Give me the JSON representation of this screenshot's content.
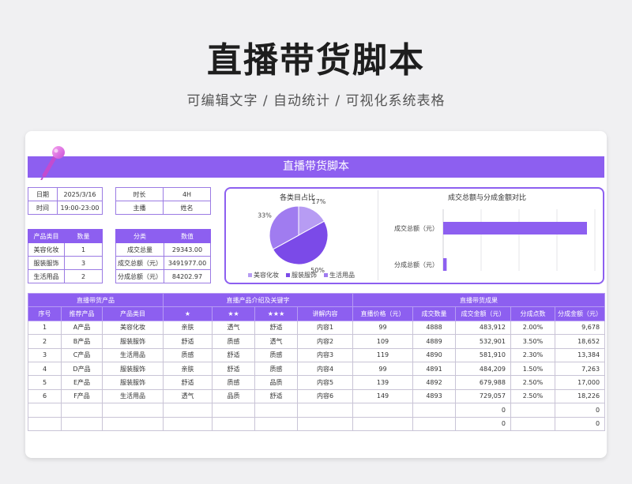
{
  "page": {
    "title": "直播带货脚本",
    "subtitle": "可编辑文字 / 自动统计 / 可视化系统表格"
  },
  "sheet": {
    "banner": "直播带货脚本",
    "info_left": [
      {
        "label": "日期",
        "value": "2025/3/16"
      },
      {
        "label": "时间",
        "value": "19:00-23:00"
      }
    ],
    "info_right": [
      {
        "label": "时长",
        "value": "4H"
      },
      {
        "label": "主播",
        "value": "姓名"
      }
    ],
    "category_table": {
      "headers": [
        "产品类目",
        "数量"
      ],
      "rows": [
        [
          "美容化妆",
          "1"
        ],
        [
          "服装服饰",
          "3"
        ],
        [
          "生活用品",
          "2"
        ]
      ]
    },
    "summary_table": {
      "headers": [
        "分类",
        "数值"
      ],
      "rows": [
        [
          "成交总量",
          "29343.00"
        ],
        [
          "成交总额（元）",
          "3491977.00"
        ],
        [
          "分成总额（元）",
          "84202.97"
        ]
      ]
    }
  },
  "chart_data": [
    {
      "type": "pie",
      "title": "各类目占比",
      "labels": [
        "美容化妆",
        "服装服饰",
        "生活用品"
      ],
      "values": [
        17,
        50,
        33
      ],
      "value_labels": [
        "17%",
        "50%",
        "33%"
      ],
      "colors": [
        "#b79cf3",
        "#7b4ae8",
        "#a07cf0"
      ],
      "legend": "bottom"
    },
    {
      "type": "bar",
      "orientation": "horizontal",
      "title": "成交总额与分成金额对比",
      "categories": [
        "成交总额（元）",
        "分成总额（元）"
      ],
      "values": [
        3491977.0,
        84202.97
      ],
      "color": "#8d5ff0",
      "grid": true
    }
  ],
  "main_table": {
    "groups": [
      "直播带货产品",
      "直播产品介绍及关键字",
      "直播带货成果"
    ],
    "columns": [
      "序号",
      "推荐产品",
      "产品类目",
      "★",
      "★★",
      "★★★",
      "讲解内容",
      "直播价格（元）",
      "成交数量",
      "成交金额（元）",
      "分成点数",
      "分成金额（元）"
    ],
    "rows": [
      [
        "1",
        "A产品",
        "美容化妆",
        "亲肤",
        "透气",
        "舒适",
        "内容1",
        "99",
        "4888",
        "483,912",
        "2.00%",
        "9,678"
      ],
      [
        "2",
        "B产品",
        "服装服饰",
        "舒适",
        "质感",
        "透气",
        "内容2",
        "109",
        "4889",
        "532,901",
        "3.50%",
        "18,652"
      ],
      [
        "3",
        "C产品",
        "生活用品",
        "质感",
        "舒适",
        "质感",
        "内容3",
        "119",
        "4890",
        "581,910",
        "2.30%",
        "13,384"
      ],
      [
        "4",
        "D产品",
        "服装服饰",
        "亲肤",
        "舒适",
        "质感",
        "内容4",
        "99",
        "4891",
        "484,209",
        "1.50%",
        "7,263"
      ],
      [
        "5",
        "E产品",
        "服装服饰",
        "舒适",
        "质感",
        "品质",
        "内容5",
        "139",
        "4892",
        "679,988",
        "2.50%",
        "17,000"
      ],
      [
        "6",
        "F产品",
        "生活用品",
        "透气",
        "品质",
        "舒适",
        "内容6",
        "149",
        "4893",
        "729,057",
        "2.50%",
        "18,226"
      ],
      [
        "",
        "",
        "",
        "",
        "",
        "",
        "",
        "",
        "",
        "0",
        "",
        "0"
      ],
      [
        "",
        "",
        "",
        "",
        "",
        "",
        "",
        "",
        "",
        "0",
        "",
        "0"
      ]
    ]
  }
}
